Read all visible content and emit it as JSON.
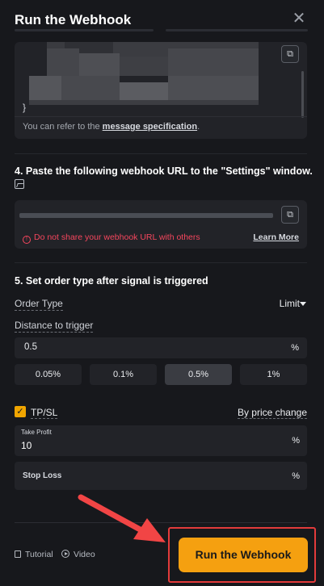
{
  "header": {
    "title": "Run the Webhook",
    "close_glyph": "✕"
  },
  "message_box": {
    "closing_brace": "}",
    "refer_prefix": "You can refer to the ",
    "refer_link": "message specification",
    "refer_suffix": ".",
    "copy_icon": "copy-icon"
  },
  "step4": {
    "title": "4. Paste the following webhook URL to the \"Settings\" window.",
    "warning": "Do not share your webhook URL with others",
    "learn_more": "Learn More"
  },
  "step5": {
    "title": "5. Set order type after signal is triggered",
    "order_type_label": "Order Type",
    "order_type_value": "Limit",
    "distance_label": "Distance to trigger",
    "distance_value": "0.5",
    "distance_unit": "%",
    "presets": [
      "0.05%",
      "0.1%",
      "0.5%",
      "1%"
    ],
    "active_preset": "0.5%",
    "tpsl_label": "TP/SL",
    "tpsl_checked": true,
    "tpsl_mode": "By price change",
    "take_profit_label": "Take Profit",
    "take_profit_value": "10",
    "take_profit_unit": "%",
    "stop_loss_label": "Stop Loss",
    "stop_loss_unit": "%"
  },
  "footer": {
    "tutorial": "Tutorial",
    "video": "Video",
    "run_button": "Run the Webhook"
  },
  "colors": {
    "accent": "#f5a010",
    "warning": "#f6465d",
    "highlight": "#e33b3b"
  }
}
